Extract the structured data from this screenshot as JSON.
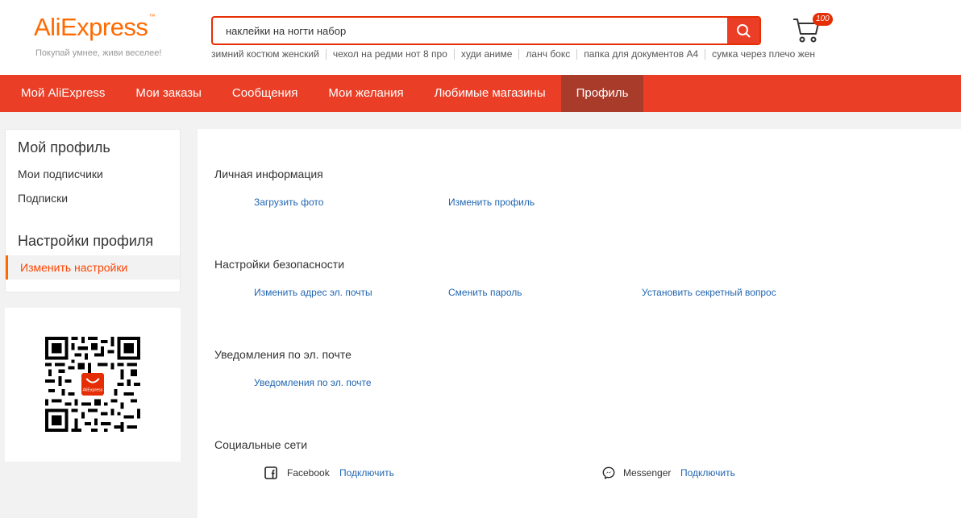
{
  "header": {
    "logo_text": "AliExpress",
    "logo_tagline": "Покупай умнее, живи веселее!",
    "search": {
      "value": "наклейки на ногти набор"
    },
    "hot_searches": [
      "зимний костюм женский",
      "чехол на редми нот 8 про",
      "худи аниме",
      "ланч бокс",
      "папка для документов А4",
      "сумка через плечо жен"
    ],
    "cart_count": "100"
  },
  "nav": {
    "items": [
      {
        "label": "Мой AliExpress"
      },
      {
        "label": "Мои заказы"
      },
      {
        "label": "Сообщения"
      },
      {
        "label": "Мои желания"
      },
      {
        "label": "Любимые магазины"
      },
      {
        "label": "Профиль",
        "active": true
      }
    ]
  },
  "sidebar": {
    "profile_heading": "Мой профиль",
    "followers": "Мои подписчики",
    "subscriptions": "Подписки",
    "settings_heading": "Настройки профиля",
    "change_settings": "Изменить настройки"
  },
  "qr": {
    "app_label": "AliExpress"
  },
  "main": {
    "personal": {
      "title": "Личная информация",
      "upload_photo": "Загрузить фото",
      "edit_profile": "Изменить профиль"
    },
    "security": {
      "title": "Настройки безопасности",
      "change_email": "Изменить адрес эл. почты",
      "change_password": "Сменить пароль",
      "secret_question": "Установить секретный вопрос"
    },
    "email_notifications": {
      "title": "Уведомления по эл. почте",
      "link": "Уведомления по эл. почте"
    },
    "social": {
      "title": "Социальные сети",
      "facebook": "Facebook",
      "facebook_connect": "Подключить",
      "messenger": "Messenger",
      "messenger_connect": "Подключить"
    }
  },
  "colors": {
    "brand_orange": "#ff6a00",
    "nav_red": "#ea3e26",
    "nav_active": "#a93b2a",
    "link_blue": "#2266b0"
  }
}
